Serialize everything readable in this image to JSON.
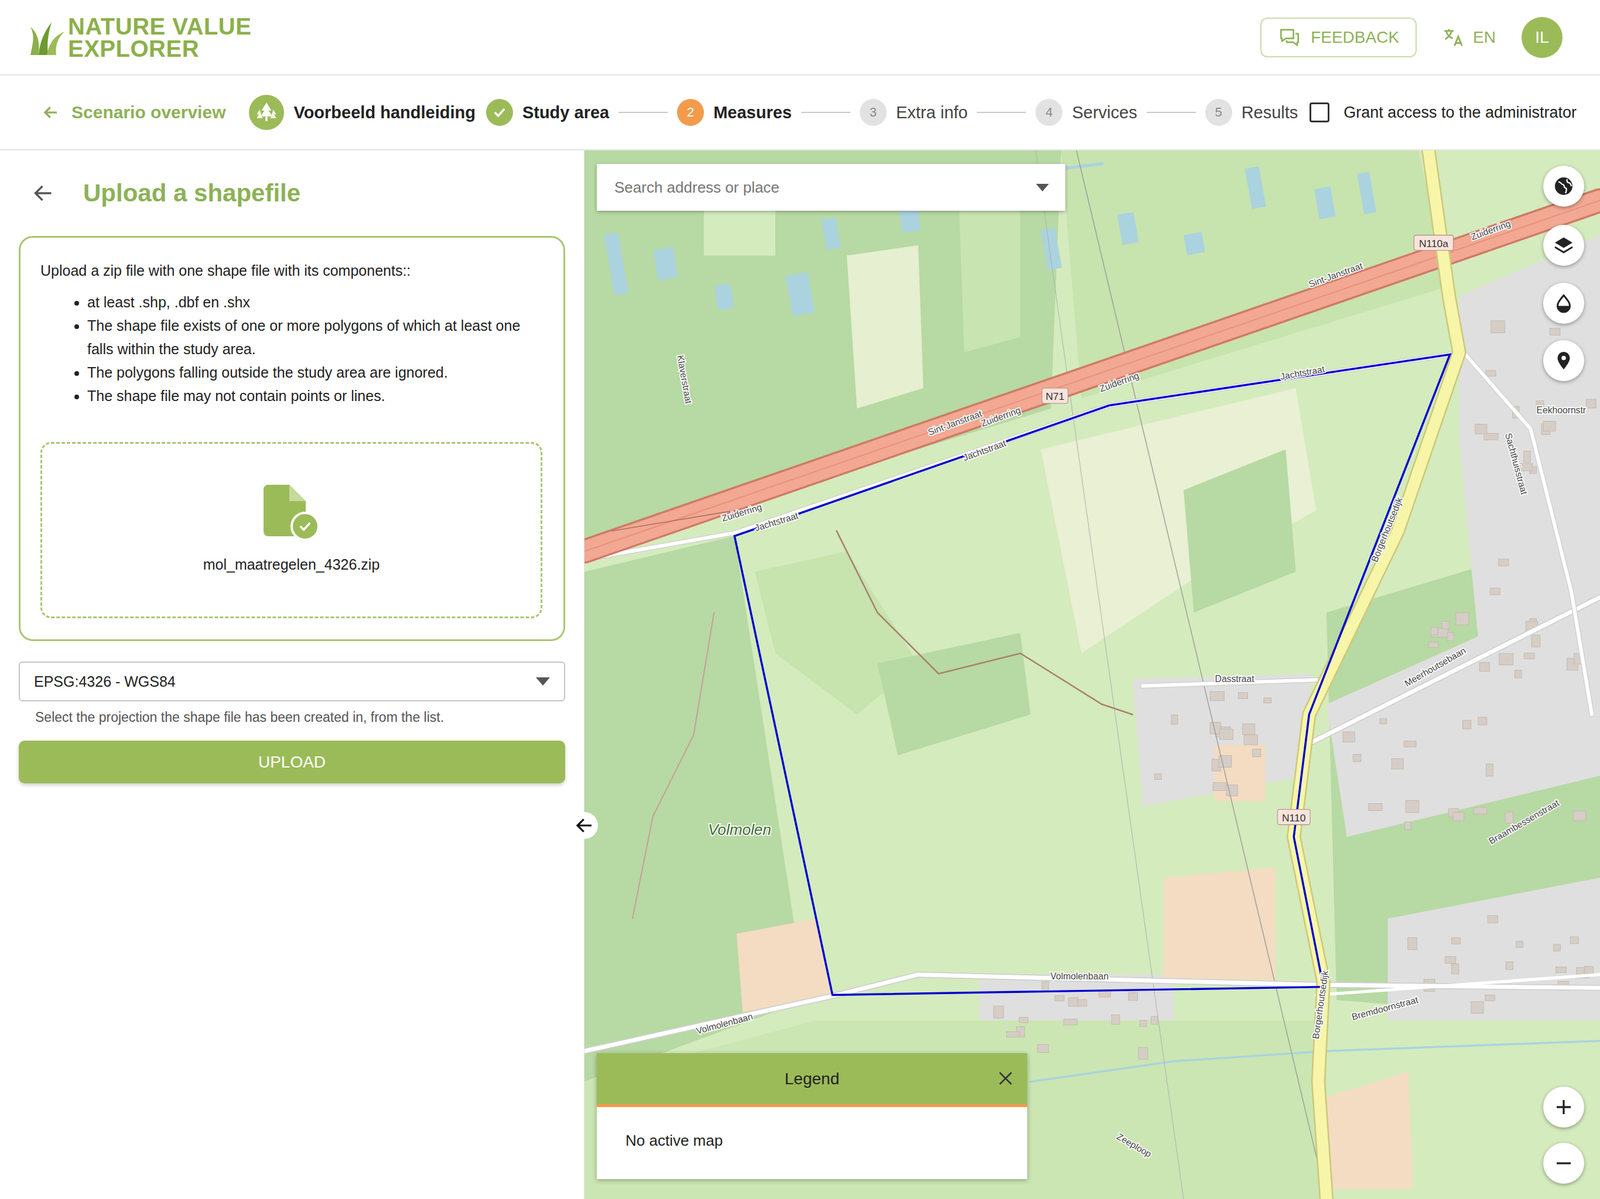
{
  "header": {
    "logo_line1": "NATURE VALUE",
    "logo_line2": "EXPLORER",
    "feedback": "FEEDBACK",
    "language": "EN",
    "avatar": "IL"
  },
  "stepper": {
    "back": "Scenario overview",
    "scenario": "Voorbeeld handleiding",
    "steps": [
      {
        "label": "Study area",
        "number": "",
        "status": "done",
        "selected": false
      },
      {
        "label": "Measures",
        "number": "2",
        "status": "active",
        "selected": true
      },
      {
        "label": "Extra info",
        "number": "3",
        "status": "pending",
        "selected": false
      },
      {
        "label": "Services",
        "number": "4",
        "status": "pending",
        "selected": false
      },
      {
        "label": "Results",
        "number": "5",
        "status": "pending",
        "selected": false
      }
    ],
    "grant_access": {
      "label": "Grant access to the administrator",
      "checked": false
    }
  },
  "panel": {
    "title": "Upload a shapefile",
    "intro": "Upload a zip file with one shape file with its components::",
    "bullets": [
      "at least .shp, .dbf en .shx",
      "The shape file exists of one or more polygons of which at least one falls within the study area.",
      "The polygons falling outside the study area are ignored.",
      "The shape file may not contain points or lines."
    ],
    "file": {
      "name": "mol_maatregelen_4326.zip",
      "uploaded": true
    },
    "projection": {
      "value": "EPSG:4326 - WGS84",
      "help": "Select the projection the shape file has been created in, from the list."
    },
    "upload": "UPLOAD"
  },
  "map": {
    "search": {
      "placeholder": "Search address or place"
    },
    "labels": [
      "Zuiderring",
      "Sint-Janstraat",
      "Jachtstraat",
      "Zuiderring",
      "Zuiderring",
      "Sint-Janstraat",
      "Jachtstraat",
      "Zuiderring",
      "Jachtstraat",
      "Klaverstraat",
      "Volmolen",
      "Dasstraat",
      "Volmolenbaan",
      "Volmolenbaan",
      "Borgerhoutsedijk",
      "Borgerhoutsedijk",
      "Sachthuisstraat",
      "Eekhoornstr",
      "Meerhoutsebaan",
      "Braambessenstraat",
      "Bremdoornstraat",
      "Zeeploop"
    ],
    "shields": [
      "N110a",
      "N71",
      "N110"
    ],
    "legend": {
      "title": "Legend",
      "body": "No active map"
    }
  }
}
